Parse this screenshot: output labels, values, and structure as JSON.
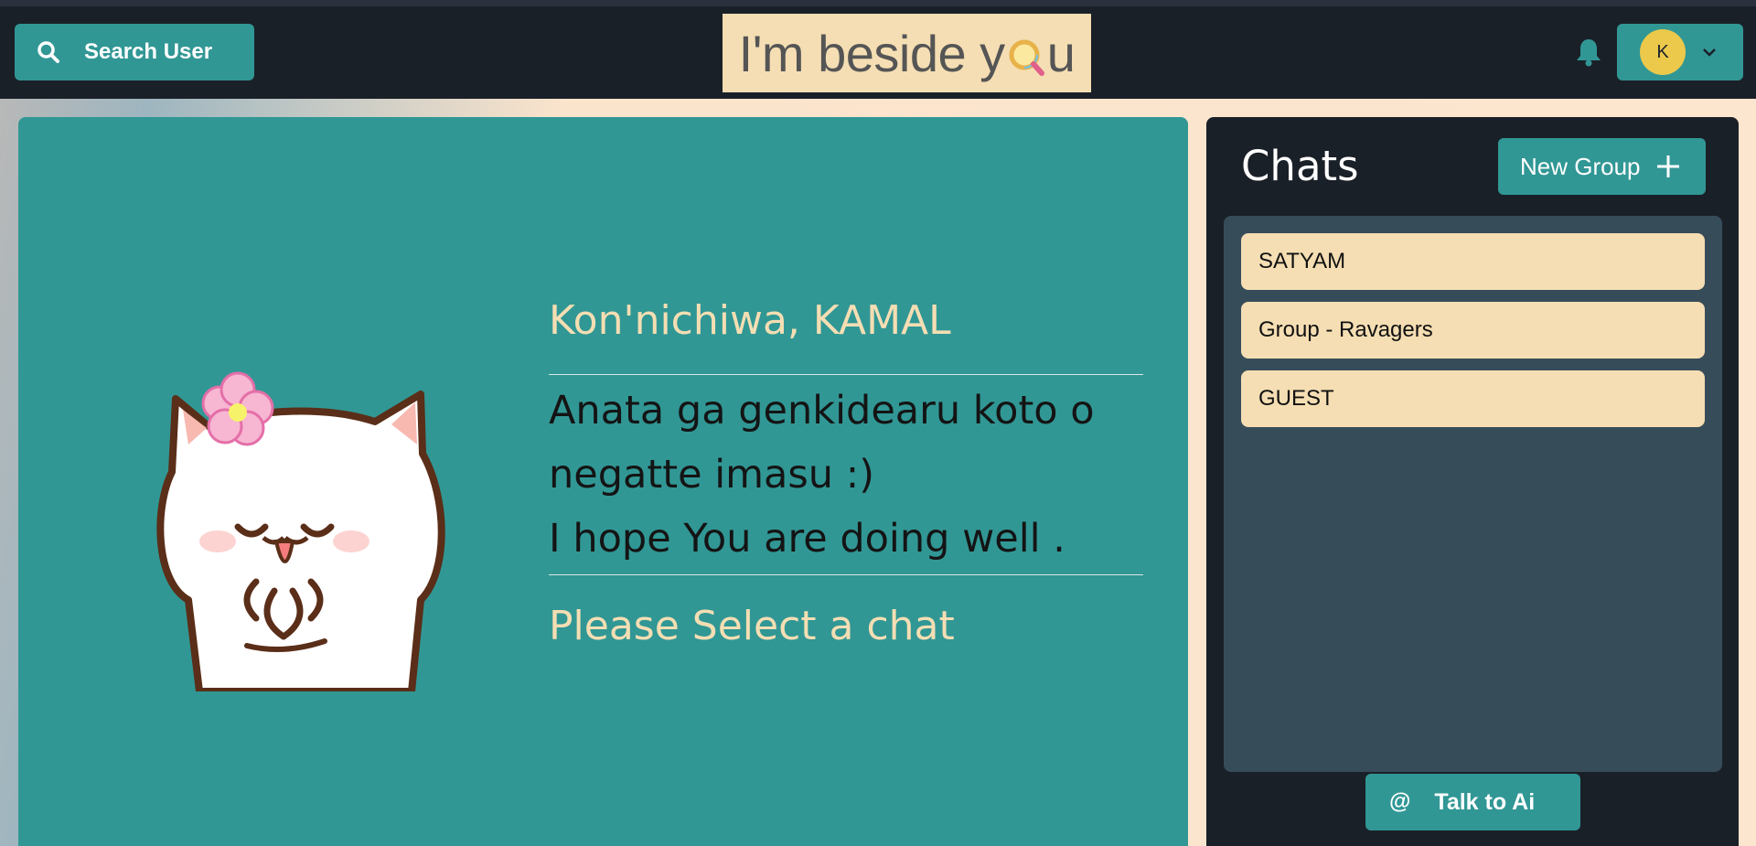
{
  "header": {
    "search_label": "Search User",
    "logo_text_before": "I'm beside y",
    "logo_text_after": "u",
    "avatar_initial": "K"
  },
  "welcome": {
    "title": "Kon'nichiwa, KAMAL",
    "line1": "Anata ga genkidearu koto o",
    "line2": "negatte imasu :)",
    "line3": "I hope You are doing well .",
    "select_prompt": "Please Select a chat"
  },
  "chats": {
    "title": "Chats",
    "new_group_label": "New Group",
    "items": [
      {
        "label": "SATYAM"
      },
      {
        "label": "Group - Ravagers"
      },
      {
        "label": "GUEST"
      }
    ],
    "ai_button_label": "Talk to Ai",
    "ai_icon_symbol": "@"
  },
  "colors": {
    "accent": "#319795",
    "cream": "#f5deb3",
    "dark": "#1a2028",
    "list_bg": "#374c59",
    "avatar": "#ecc94b"
  }
}
